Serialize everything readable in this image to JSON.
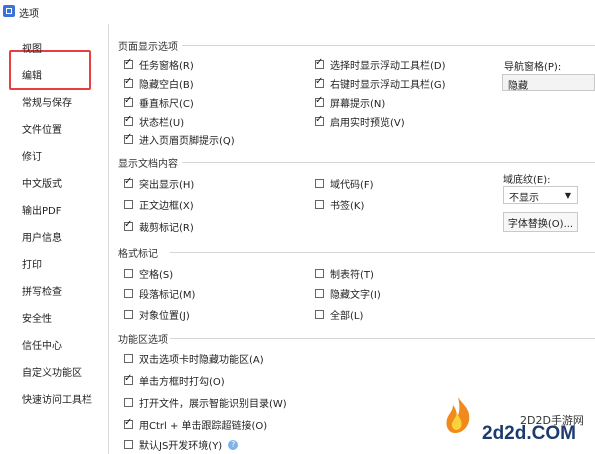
{
  "window": {
    "title": "选项"
  },
  "sidebar": {
    "items": [
      {
        "label": "视图"
      },
      {
        "label": "编辑"
      },
      {
        "label": "常规与保存"
      },
      {
        "label": "文件位置"
      },
      {
        "label": "修订"
      },
      {
        "label": "中文版式"
      },
      {
        "label": "输出PDF"
      },
      {
        "label": "用户信息"
      },
      {
        "label": "打印"
      },
      {
        "label": "拼写检查"
      },
      {
        "label": "安全性"
      },
      {
        "label": "信任中心"
      },
      {
        "label": "自定义功能区"
      },
      {
        "label": "快速访问工具栏"
      }
    ]
  },
  "sections": {
    "page_display": {
      "title": "页面显示选项",
      "items": [
        {
          "label": "任务窗格(R)",
          "checked": true
        },
        {
          "label": "隐藏空白(B)",
          "checked": true
        },
        {
          "label": "垂直标尺(C)",
          "checked": true
        },
        {
          "label": "状态栏(U)",
          "checked": true
        },
        {
          "label": "进入页眉页脚提示(Q)",
          "checked": true
        },
        {
          "label": "选择时显示浮动工具栏(D)",
          "checked": true
        },
        {
          "label": "右键时显示浮动工具栏(G)",
          "checked": true
        },
        {
          "label": "屏幕提示(N)",
          "checked": true
        },
        {
          "label": "启用实时预览(V)",
          "checked": true
        }
      ],
      "nav_pane": {
        "label": "导航窗格(P):",
        "value": "隐藏"
      }
    },
    "doc_content": {
      "title": "显示文档内容",
      "items": [
        {
          "label": "突出显示(H)",
          "checked": true
        },
        {
          "label": "正文边框(X)",
          "checked": false
        },
        {
          "label": "裁剪标记(R)",
          "checked": true
        },
        {
          "label": "域代码(F)",
          "checked": false
        },
        {
          "label": "书签(K)",
          "checked": false
        }
      ],
      "field_shading": {
        "label": "域底纹(E):",
        "value": "不显示"
      },
      "font_replace_button": "字体替换(O)..."
    },
    "format_marks": {
      "title": "格式标记",
      "items": [
        {
          "label": "空格(S)",
          "checked": false
        },
        {
          "label": "段落标记(M)",
          "checked": false
        },
        {
          "label": "对象位置(J)",
          "checked": false
        },
        {
          "label": "制表符(T)",
          "checked": false
        },
        {
          "label": "隐藏文字(I)",
          "checked": false
        },
        {
          "label": "全部(L)",
          "checked": false
        }
      ]
    },
    "ribbon": {
      "title": "功能区选项",
      "items": [
        {
          "label": "双击选项卡时隐藏功能区(A)",
          "checked": false
        },
        {
          "label": "单击方框时打勾(O)",
          "checked": true
        },
        {
          "label": "打开文件，展示智能识别目录(W)",
          "checked": false
        },
        {
          "label": "用Ctrl + 单击跟踪超链接(O)",
          "checked": true
        },
        {
          "label": "默认JS开发环境(Y)",
          "checked": false
        }
      ]
    }
  },
  "watermark": {
    "site": "2D2D手游网",
    "domain": "2d2d.COM"
  },
  "colors": {
    "highlight_border": "#e73f3f",
    "accent": "#3c74d6"
  }
}
